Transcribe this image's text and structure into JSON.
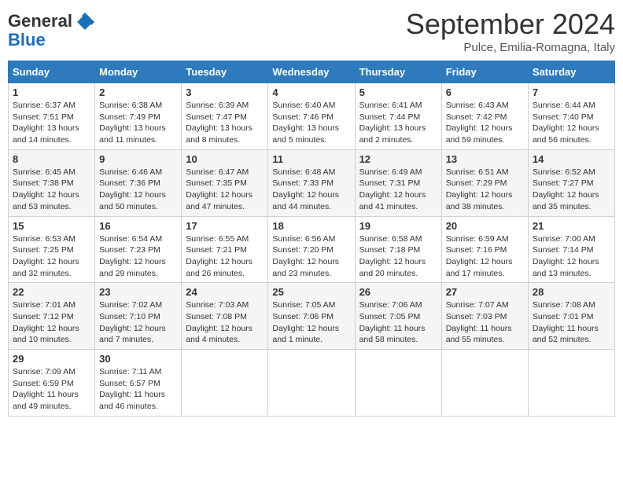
{
  "header": {
    "logo_line1": "General",
    "logo_line2": "Blue",
    "title": "September 2024",
    "subtitle": "Pulce, Emilia-Romagna, Italy"
  },
  "days_of_week": [
    "Sunday",
    "Monday",
    "Tuesday",
    "Wednesday",
    "Thursday",
    "Friday",
    "Saturday"
  ],
  "weeks": [
    [
      {
        "day": "1",
        "detail": "Sunrise: 6:37 AM\nSunset: 7:51 PM\nDaylight: 13 hours\nand 14 minutes."
      },
      {
        "day": "2",
        "detail": "Sunrise: 6:38 AM\nSunset: 7:49 PM\nDaylight: 13 hours\nand 11 minutes."
      },
      {
        "day": "3",
        "detail": "Sunrise: 6:39 AM\nSunset: 7:47 PM\nDaylight: 13 hours\nand 8 minutes."
      },
      {
        "day": "4",
        "detail": "Sunrise: 6:40 AM\nSunset: 7:46 PM\nDaylight: 13 hours\nand 5 minutes."
      },
      {
        "day": "5",
        "detail": "Sunrise: 6:41 AM\nSunset: 7:44 PM\nDaylight: 13 hours\nand 2 minutes."
      },
      {
        "day": "6",
        "detail": "Sunrise: 6:43 AM\nSunset: 7:42 PM\nDaylight: 12 hours\nand 59 minutes."
      },
      {
        "day": "7",
        "detail": "Sunrise: 6:44 AM\nSunset: 7:40 PM\nDaylight: 12 hours\nand 56 minutes."
      }
    ],
    [
      {
        "day": "8",
        "detail": "Sunrise: 6:45 AM\nSunset: 7:38 PM\nDaylight: 12 hours\nand 53 minutes."
      },
      {
        "day": "9",
        "detail": "Sunrise: 6:46 AM\nSunset: 7:36 PM\nDaylight: 12 hours\nand 50 minutes."
      },
      {
        "day": "10",
        "detail": "Sunrise: 6:47 AM\nSunset: 7:35 PM\nDaylight: 12 hours\nand 47 minutes."
      },
      {
        "day": "11",
        "detail": "Sunrise: 6:48 AM\nSunset: 7:33 PM\nDaylight: 12 hours\nand 44 minutes."
      },
      {
        "day": "12",
        "detail": "Sunrise: 6:49 AM\nSunset: 7:31 PM\nDaylight: 12 hours\nand 41 minutes."
      },
      {
        "day": "13",
        "detail": "Sunrise: 6:51 AM\nSunset: 7:29 PM\nDaylight: 12 hours\nand 38 minutes."
      },
      {
        "day": "14",
        "detail": "Sunrise: 6:52 AM\nSunset: 7:27 PM\nDaylight: 12 hours\nand 35 minutes."
      }
    ],
    [
      {
        "day": "15",
        "detail": "Sunrise: 6:53 AM\nSunset: 7:25 PM\nDaylight: 12 hours\nand 32 minutes."
      },
      {
        "day": "16",
        "detail": "Sunrise: 6:54 AM\nSunset: 7:23 PM\nDaylight: 12 hours\nand 29 minutes."
      },
      {
        "day": "17",
        "detail": "Sunrise: 6:55 AM\nSunset: 7:21 PM\nDaylight: 12 hours\nand 26 minutes."
      },
      {
        "day": "18",
        "detail": "Sunrise: 6:56 AM\nSunset: 7:20 PM\nDaylight: 12 hours\nand 23 minutes."
      },
      {
        "day": "19",
        "detail": "Sunrise: 6:58 AM\nSunset: 7:18 PM\nDaylight: 12 hours\nand 20 minutes."
      },
      {
        "day": "20",
        "detail": "Sunrise: 6:59 AM\nSunset: 7:16 PM\nDaylight: 12 hours\nand 17 minutes."
      },
      {
        "day": "21",
        "detail": "Sunrise: 7:00 AM\nSunset: 7:14 PM\nDaylight: 12 hours\nand 13 minutes."
      }
    ],
    [
      {
        "day": "22",
        "detail": "Sunrise: 7:01 AM\nSunset: 7:12 PM\nDaylight: 12 hours\nand 10 minutes."
      },
      {
        "day": "23",
        "detail": "Sunrise: 7:02 AM\nSunset: 7:10 PM\nDaylight: 12 hours\nand 7 minutes."
      },
      {
        "day": "24",
        "detail": "Sunrise: 7:03 AM\nSunset: 7:08 PM\nDaylight: 12 hours\nand 4 minutes."
      },
      {
        "day": "25",
        "detail": "Sunrise: 7:05 AM\nSunset: 7:06 PM\nDaylight: 12 hours\nand 1 minute."
      },
      {
        "day": "26",
        "detail": "Sunrise: 7:06 AM\nSunset: 7:05 PM\nDaylight: 11 hours\nand 58 minutes."
      },
      {
        "day": "27",
        "detail": "Sunrise: 7:07 AM\nSunset: 7:03 PM\nDaylight: 11 hours\nand 55 minutes."
      },
      {
        "day": "28",
        "detail": "Sunrise: 7:08 AM\nSunset: 7:01 PM\nDaylight: 11 hours\nand 52 minutes."
      }
    ],
    [
      {
        "day": "29",
        "detail": "Sunrise: 7:09 AM\nSunset: 6:59 PM\nDaylight: 11 hours\nand 49 minutes."
      },
      {
        "day": "30",
        "detail": "Sunrise: 7:11 AM\nSunset: 6:57 PM\nDaylight: 11 hours\nand 46 minutes."
      },
      {
        "day": "",
        "detail": ""
      },
      {
        "day": "",
        "detail": ""
      },
      {
        "day": "",
        "detail": ""
      },
      {
        "day": "",
        "detail": ""
      },
      {
        "day": "",
        "detail": ""
      }
    ]
  ]
}
